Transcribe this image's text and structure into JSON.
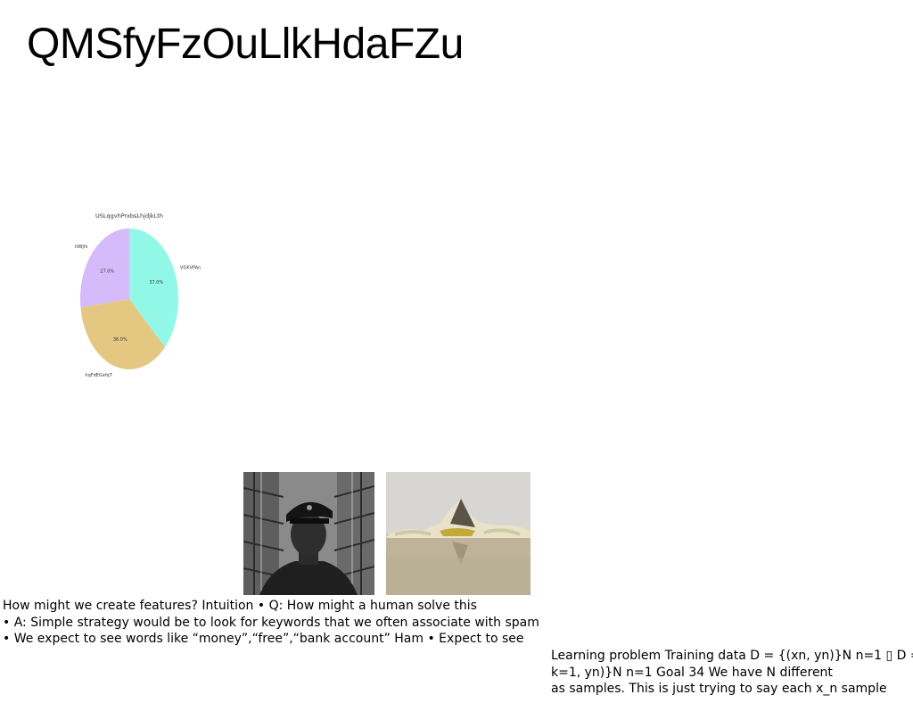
{
  "title": "QMSfyFzOuLlkHdaFZu",
  "chart_data": {
    "type": "pie",
    "title": "USLqgvhPrxbsLhjdjkLth",
    "slices": [
      {
        "label": "VGKVPAn",
        "value": 37.0,
        "pct_label": "37.0%",
        "color": "#91f8e8"
      },
      {
        "label": "hqFdEGxfqT",
        "value": 36.0,
        "pct_label": "36.0%",
        "color": "#e4c882"
      },
      {
        "label": "rtWjhi",
        "value": 27.0,
        "pct_label": "27.0%",
        "color": "#d6bbfb"
      }
    ],
    "start_angle_deg": 90,
    "direction": "clockwise",
    "legend": "none"
  },
  "images": {
    "photo_1": "black-and-white portrait of a uniformed man in front of fire escapes",
    "photo_2": "rocky islet with yellow foliage reflected in calm water"
  },
  "text_left": {
    "lines": [
      "How might we create features? Intuition • Q: How might a human solve this",
      "• A: Simple strategy would be to look for keywords that we often associate with spam",
      "• We expect to see words like “money”,“free”,“bank account” Ham • Expect to see"
    ]
  },
  "text_right": {
    "lines": [
      "Learning problem Training data D = {(xn, yn)}N n=1 ▯ D =",
      "k=1, yn)}N n=1 Goal 34 We have N different",
      "as samples. This is just trying to say each x_n sample"
    ]
  }
}
